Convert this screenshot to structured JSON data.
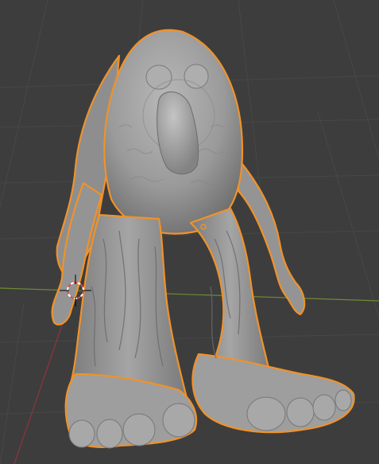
{
  "viewport": {
    "background_color": "#3d3d3d",
    "grid_line_color": "#4a4a4a",
    "x_axis_color": "#8aa83a",
    "y_axis_color": "#9b3b47"
  },
  "scene": {
    "selected_object": {
      "type": "sculpted-creature-mesh",
      "mesh_color": "#9c9c9c",
      "selection_outline_color": "#f0922a",
      "origin_color": "#f0922a"
    },
    "cursor_icon": "3d-cursor-icon"
  }
}
